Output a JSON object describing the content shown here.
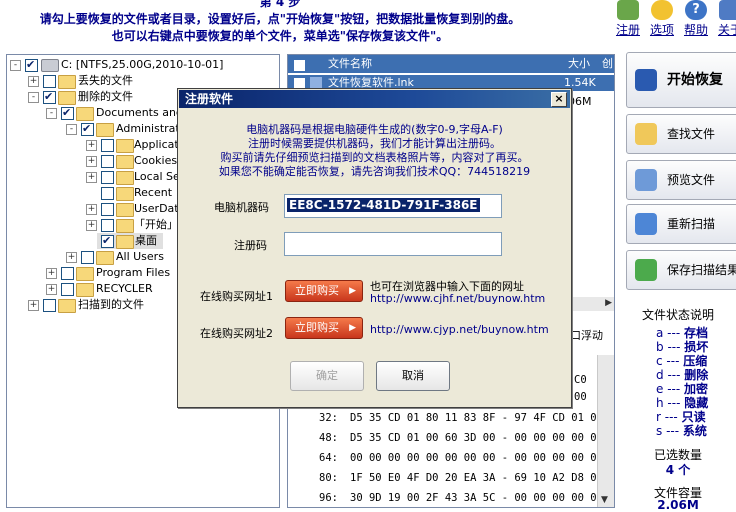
{
  "instructions": {
    "step": "第 4 步",
    "line1": "请勾上要恢复的文件或者目录，设置好后，点\"开始恢复\"按钮，把数据批量恢复到别的盘。",
    "line2": "也可以右键点中要恢复的单个文件，菜单选\"保存恢复该文件\"。"
  },
  "toolbar": {
    "items": [
      {
        "label": "注册",
        "icon": "cart-icon"
      },
      {
        "label": "选项",
        "icon": "gear-icon"
      },
      {
        "label": "帮助",
        "icon": "help-icon"
      },
      {
        "label": "关于",
        "icon": "home-icon"
      }
    ]
  },
  "tree": {
    "nodes": [
      {
        "label": "C: [NTFS,25.00G,2010-10-01]",
        "checked": true,
        "expander": "-"
      },
      {
        "label": "丢失的文件",
        "checked": false,
        "expander": "+"
      },
      {
        "label": "删除的文件",
        "checked": true,
        "expander": "-"
      },
      {
        "label": "Documents and S",
        "checked": true,
        "expander": "-"
      },
      {
        "label": "Administrator",
        "checked": true,
        "expander": "-"
      },
      {
        "label": "Applicatio",
        "checked": false,
        "expander": "+"
      },
      {
        "label": "Cookies",
        "checked": false,
        "expander": "+"
      },
      {
        "label": "Local Set",
        "checked": false,
        "expander": "+"
      },
      {
        "label": "Recent",
        "checked": false,
        "expander": ""
      },
      {
        "label": "UserData",
        "checked": false,
        "expander": "+"
      },
      {
        "label": "「开始」",
        "checked": false,
        "expander": "+"
      },
      {
        "label": "桌面",
        "checked": true,
        "expander": ""
      },
      {
        "label": "All Users",
        "checked": false,
        "expander": "+"
      },
      {
        "label": "Program Files",
        "checked": false,
        "expander": "+"
      },
      {
        "label": "RECYCLER",
        "checked": false,
        "expander": "+"
      },
      {
        "label": "扫描到的文件",
        "checked": false,
        "expander": "+"
      }
    ]
  },
  "list": {
    "col_name": "文件名称",
    "col_size": "大小",
    "col_extra": "创",
    "row1_name": "文件恢复软件.lnk",
    "row1_size": "1.54K",
    "row2_size": "06M",
    "float_label": "口浮动"
  },
  "hex": {
    "rows": [
      {
        "offset": "",
        "bytes": "C0"
      },
      {
        "offset": "",
        "bytes": "00"
      },
      {
        "offset": "32:",
        "bytes": "D5 35 CD 01 80 11 83 8F - 97 4F CD 01 00"
      },
      {
        "offset": "48:",
        "bytes": "D5 35 CD 01 00 60 3D 00 - 00 00 00 00 01"
      },
      {
        "offset": "64:",
        "bytes": "00 00 00 00 00 00 00 00 - 00 00 00 00 0F"
      },
      {
        "offset": "80:",
        "bytes": "1F 50 E0 4F D0 20 EA 3A - 69 10 A2 D8 08"
      },
      {
        "offset": "96:",
        "bytes": "30 9D 19 00 2F 43 3A 5C - 00 00 00 00 00"
      }
    ]
  },
  "actions": {
    "start": "开始恢复",
    "find": "查找文件",
    "preview": "预览文件",
    "rescan": "重新扫描",
    "save_scan": "保存扫描结果"
  },
  "status_legend": {
    "title": "文件状态说明",
    "items": [
      {
        "key": "a",
        "label": "存档"
      },
      {
        "key": "b",
        "label": "损坏"
      },
      {
        "key": "c",
        "label": "压缩"
      },
      {
        "key": "d",
        "label": "删除"
      },
      {
        "key": "e",
        "label": "加密"
      },
      {
        "key": "h",
        "label": "隐藏"
      },
      {
        "key": "r",
        "label": "只读"
      },
      {
        "key": "s",
        "label": "系统"
      }
    ],
    "selected_label": "已选数量",
    "selected_value": "4 个",
    "capacity_label": "文件容量",
    "capacity_value": "2.06M"
  },
  "dialog": {
    "title": "注册软件",
    "close": "×",
    "note1": "电脑机器码是根据电脑硬件生成的(数字0-9,字母A-F)",
    "note2": "注册时候需要提供机器码，我们才能计算出注册码。",
    "note3": "购买前请先仔细预览扫描到的文档表格照片等，内容对了再买。",
    "note4": "如果您不能确定能否恢复，请先咨询我们技术QQ：744518219",
    "machine_label": "电脑机器码",
    "machine_value": "EE8C-1572-481D-791F-386E",
    "reg_label": "注册码",
    "reg_value": "",
    "buy1_label": "在线购买网址1",
    "buy2_label": "在线购买网址2",
    "buy_button": "立即购买",
    "buy1_hint": "也可在浏览器中输入下面的网址",
    "buy1_url": "http://www.cjhf.net/buynow.htm",
    "buy2_url": "http://www.cjyp.net/buynow.htm",
    "ok": "确定",
    "cancel": "取消"
  }
}
